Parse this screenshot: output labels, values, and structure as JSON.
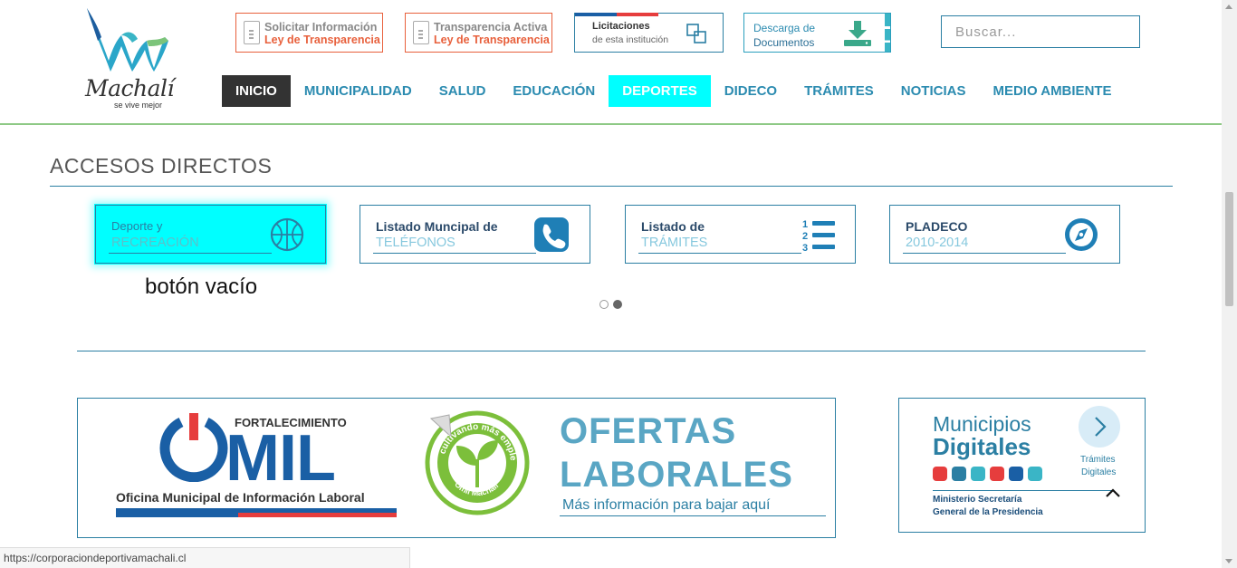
{
  "logo": {
    "word": "Machalí",
    "tagline": "se vive mejor"
  },
  "header_buttons": [
    {
      "line1": "Solicitar Información",
      "line2": "Ley de Transparencia"
    },
    {
      "line1": "Transparencia Activa",
      "line2": "Ley de Transparencia"
    }
  ],
  "licitaciones": {
    "line1": "Licitaciones",
    "line2": "de esta institución"
  },
  "descarga": {
    "line1": "Descarga de",
    "line2": "Documentos"
  },
  "search": {
    "placeholder": "Buscar..."
  },
  "nav": {
    "items": [
      {
        "label": "INICIO"
      },
      {
        "label": "MUNICIPALIDAD"
      },
      {
        "label": "SALUD"
      },
      {
        "label": "EDUCACIÓN"
      },
      {
        "label": "DEPORTES"
      },
      {
        "label": "DIDECO"
      },
      {
        "label": "TRÁMITES"
      },
      {
        "label": "NOTICIAS"
      },
      {
        "label": "MEDIO AMBIENTE"
      }
    ]
  },
  "accesos": {
    "title": "ACCESOS DIRECTOS",
    "cards": [
      {
        "line1": "Deporte y",
        "line2": "RECREACIÓN"
      },
      {
        "line1": "Listado Muncipal de",
        "line2": "TELÉFONOS"
      },
      {
        "line1": "Listado de",
        "line2": "TRÁMITES"
      },
      {
        "line1": "PLADECO",
        "line2": "2010-2014"
      }
    ],
    "caption": "botón vacío",
    "carousel": {
      "pages": 2,
      "current": 2
    }
  },
  "omil_banner": {
    "fortalecimiento": "FORTALECIMIENTO",
    "omil": "MIL",
    "subtitle": "Oficina Municipal de Información Laboral",
    "seal_top": "cultivando más empleo",
    "seal_bottom": "Omil Machalí",
    "ofertas1": "OFERTAS",
    "ofertas2": "LABORALES",
    "ofertas3": "Más información para bajar aquí"
  },
  "municipios": {
    "line1": "Municipios",
    "line2": "Digitales",
    "ministry1": "Ministerio Secretaría",
    "ministry2": "General de la Presidencia",
    "tramites1": "Trámites",
    "tramites2": "Digitales"
  },
  "status_bar": {
    "url": "https://corporaciondeportivamachali.cl"
  },
  "colors": {
    "accent": "#2b8bb0",
    "active_nav": "#00ffff",
    "home_nav": "#333333",
    "transparency": "#e8603c",
    "header_rule": "#8ec985"
  }
}
